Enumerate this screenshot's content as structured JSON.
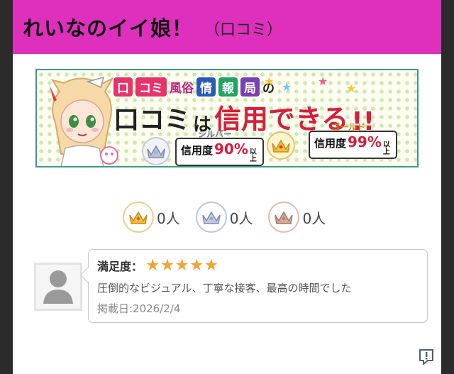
{
  "header": {
    "title": "れいなのイイ娘！",
    "subtitle": "（口コミ）"
  },
  "banner": {
    "logo": [
      "口",
      "コミ",
      "風俗",
      "情",
      "報",
      "局",
      "の"
    ],
    "head_kuchi": "口コミ",
    "head_ha": "は",
    "head_trust": "信用できる",
    "head_bang": "!!",
    "silver": {
      "rank": "シルバー",
      "label": "信用度",
      "percent": "90%",
      "above": "以上"
    },
    "gold": {
      "rank": "ゴールド",
      "label": "信用度",
      "percent": "99%",
      "above": "以上"
    }
  },
  "counts": [
    {
      "type": "gold",
      "value": "0人"
    },
    {
      "type": "silver",
      "value": "0人"
    },
    {
      "type": "bronze",
      "value": "0人"
    }
  ],
  "review": {
    "rating_label": "満足度：",
    "rating": 5,
    "comment": "圧倒的なビジュアル、丁寧な接客、最高の時間でした",
    "posted": "掲載日:2026/2/4"
  },
  "colors": {
    "header_bg": "#de2fbd",
    "star": "#f0a533",
    "accent_red": "#d81d3e",
    "gold": "#e0a826",
    "silver": "#9aa6c4",
    "bronze": "#c49480"
  }
}
